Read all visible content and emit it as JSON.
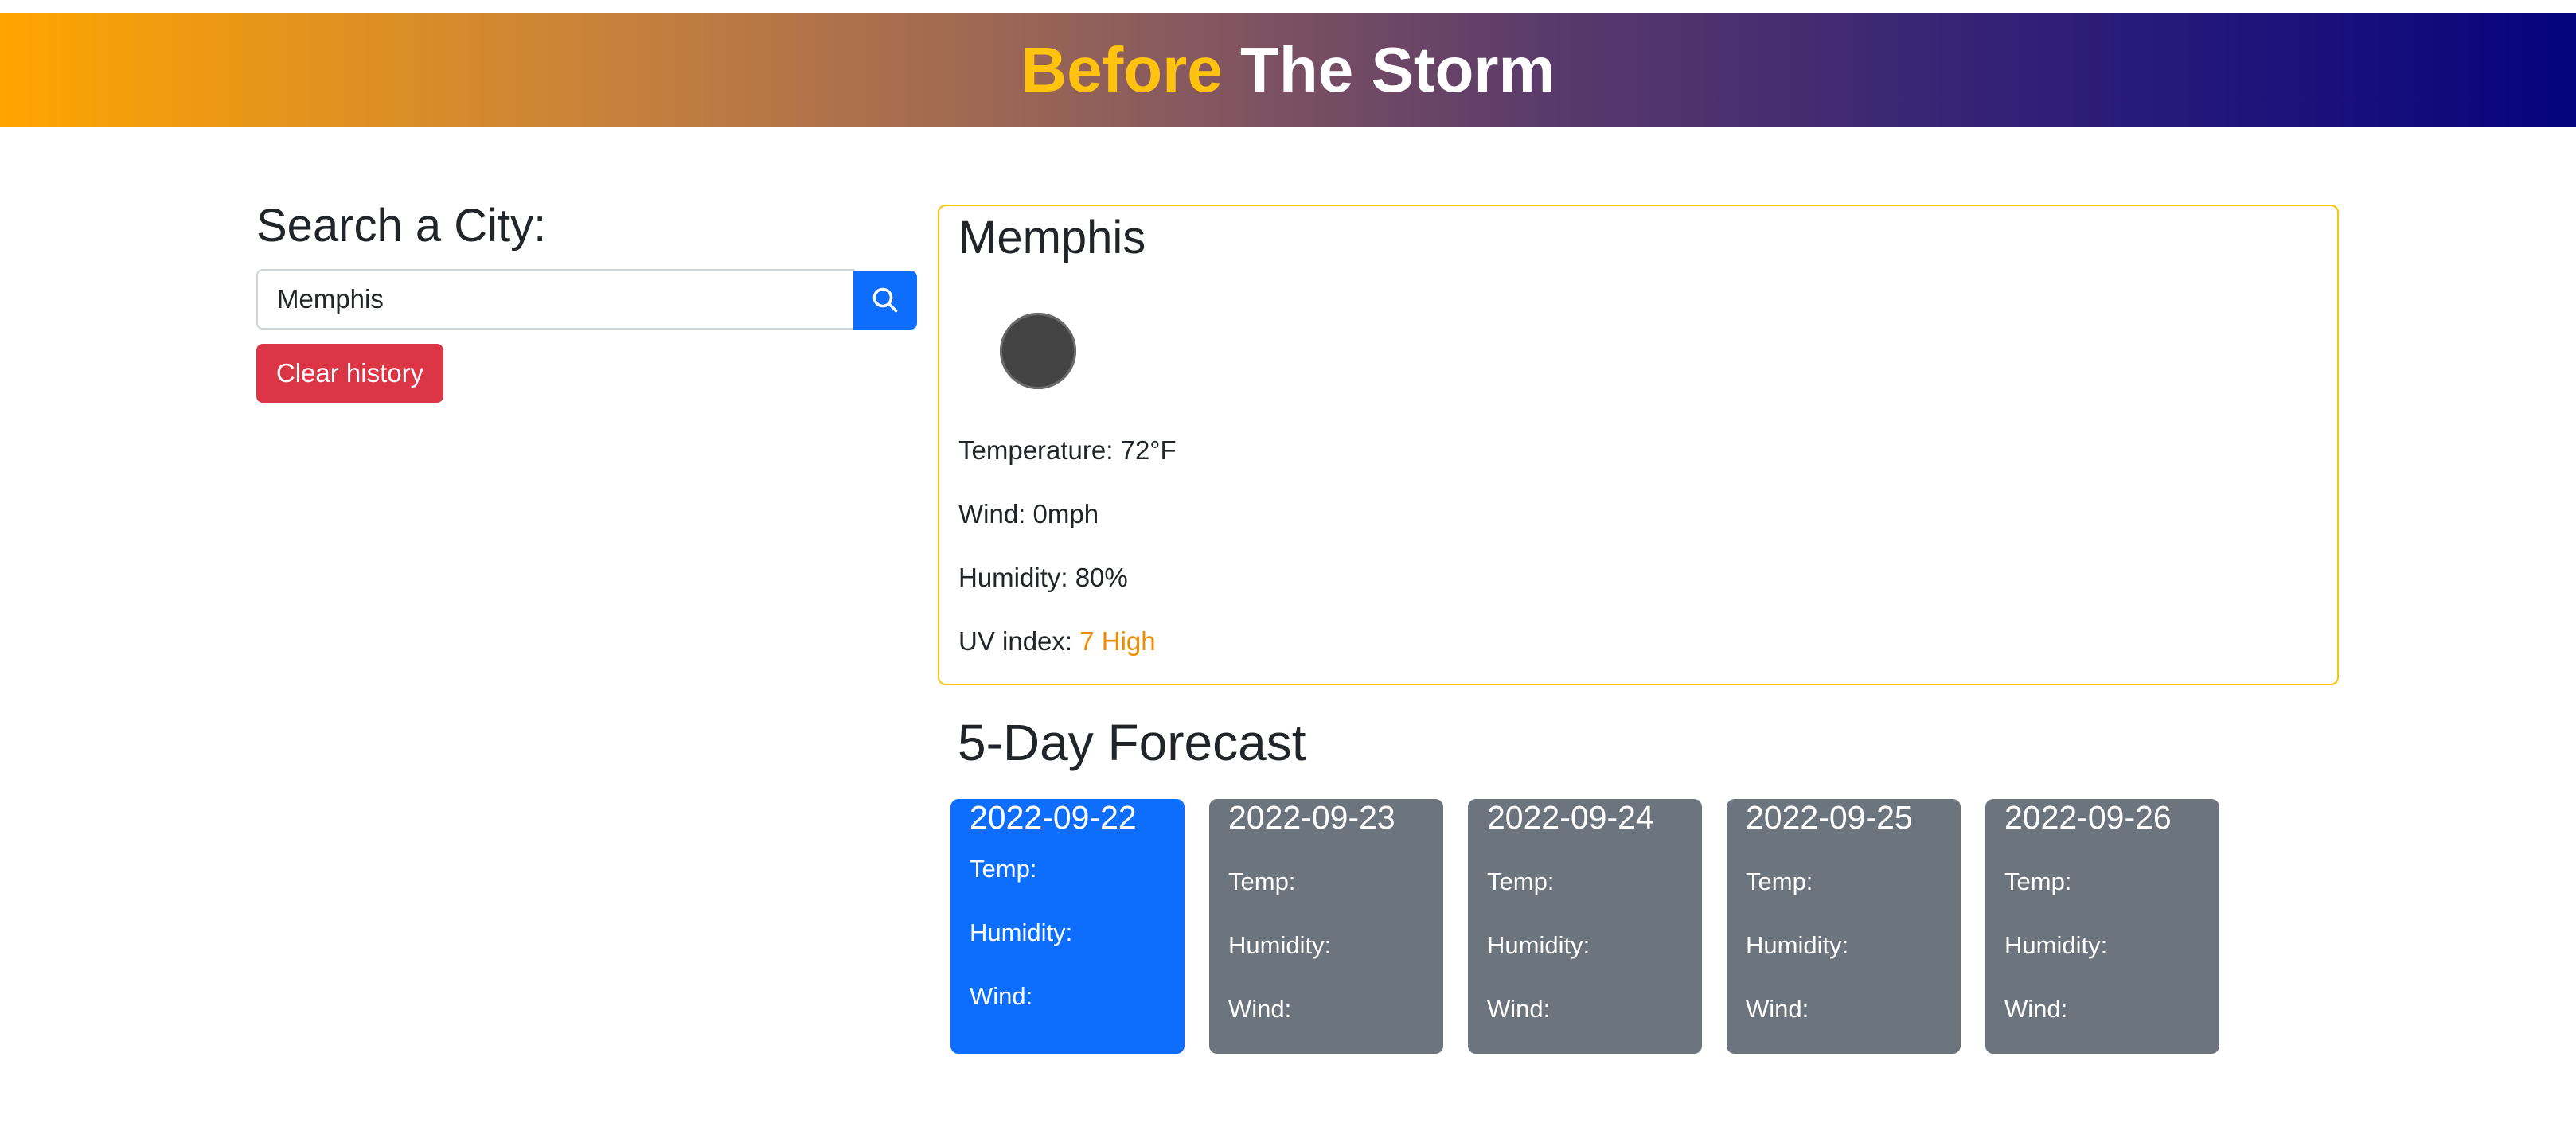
{
  "header": {
    "title_part1": "Before",
    "title_part2": "The Storm"
  },
  "search": {
    "heading": "Search a City:",
    "input_value": "Memphis",
    "button_icon": "search-icon",
    "clear_label": "Clear history"
  },
  "current": {
    "city": "Memphis",
    "icon": "weather-icon",
    "temperature": "Temperature: 72°F",
    "wind": "Wind: 0mph",
    "humidity": "Humidity: 80%",
    "uv_label": "UV index: ",
    "uv_value": "7 High"
  },
  "forecast": {
    "heading": "5-Day Forecast",
    "days": [
      {
        "date": "2022-09-22",
        "temp": "Temp:",
        "humidity": "Humidity:",
        "wind": "Wind:"
      },
      {
        "date": "2022-09-23",
        "temp": "Temp:",
        "humidity": "Humidity:",
        "wind": "Wind:"
      },
      {
        "date": "2022-09-24",
        "temp": "Temp:",
        "humidity": "Humidity:",
        "wind": "Wind:"
      },
      {
        "date": "2022-09-25",
        "temp": "Temp:",
        "humidity": "Humidity:",
        "wind": "Wind:"
      },
      {
        "date": "2022-09-26",
        "temp": "Temp:",
        "humidity": "Humidity:",
        "wind": "Wind:"
      }
    ]
  },
  "colors": {
    "accent_yellow": "#ffc20e",
    "primary_blue": "#0d6efd",
    "danger_red": "#dc3545",
    "card_gray": "#6c757d",
    "card_border": "#ffc107",
    "uv_high": "#f08c00"
  }
}
